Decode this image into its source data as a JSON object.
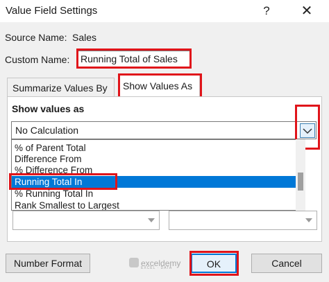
{
  "window": {
    "title": "Value Field Settings",
    "help_glyph": "?",
    "close_glyph": "✕"
  },
  "source": {
    "label": "Source Name:",
    "value": "Sales"
  },
  "custom_name": {
    "label": "Custom Name:",
    "value": "Running Total of Sales"
  },
  "tabs": [
    {
      "label": "Summarize Values By",
      "active": false
    },
    {
      "label": "Show Values As",
      "active": true
    }
  ],
  "show_values": {
    "heading": "Show values as",
    "selected": "No Calculation",
    "options": [
      "% of Parent Total",
      "Difference From",
      "% Difference From",
      "Running Total In",
      "% Running Total In",
      "Rank Smallest to Largest"
    ],
    "highlighted_index": 3
  },
  "buttons": {
    "number_format": "Number Format",
    "ok": "OK",
    "cancel": "Cancel"
  },
  "watermark": {
    "name": "exceldemy",
    "sub": "EXCEL · DATA"
  },
  "colors": {
    "highlight": "#e0141a",
    "selection": "#0078d7"
  }
}
